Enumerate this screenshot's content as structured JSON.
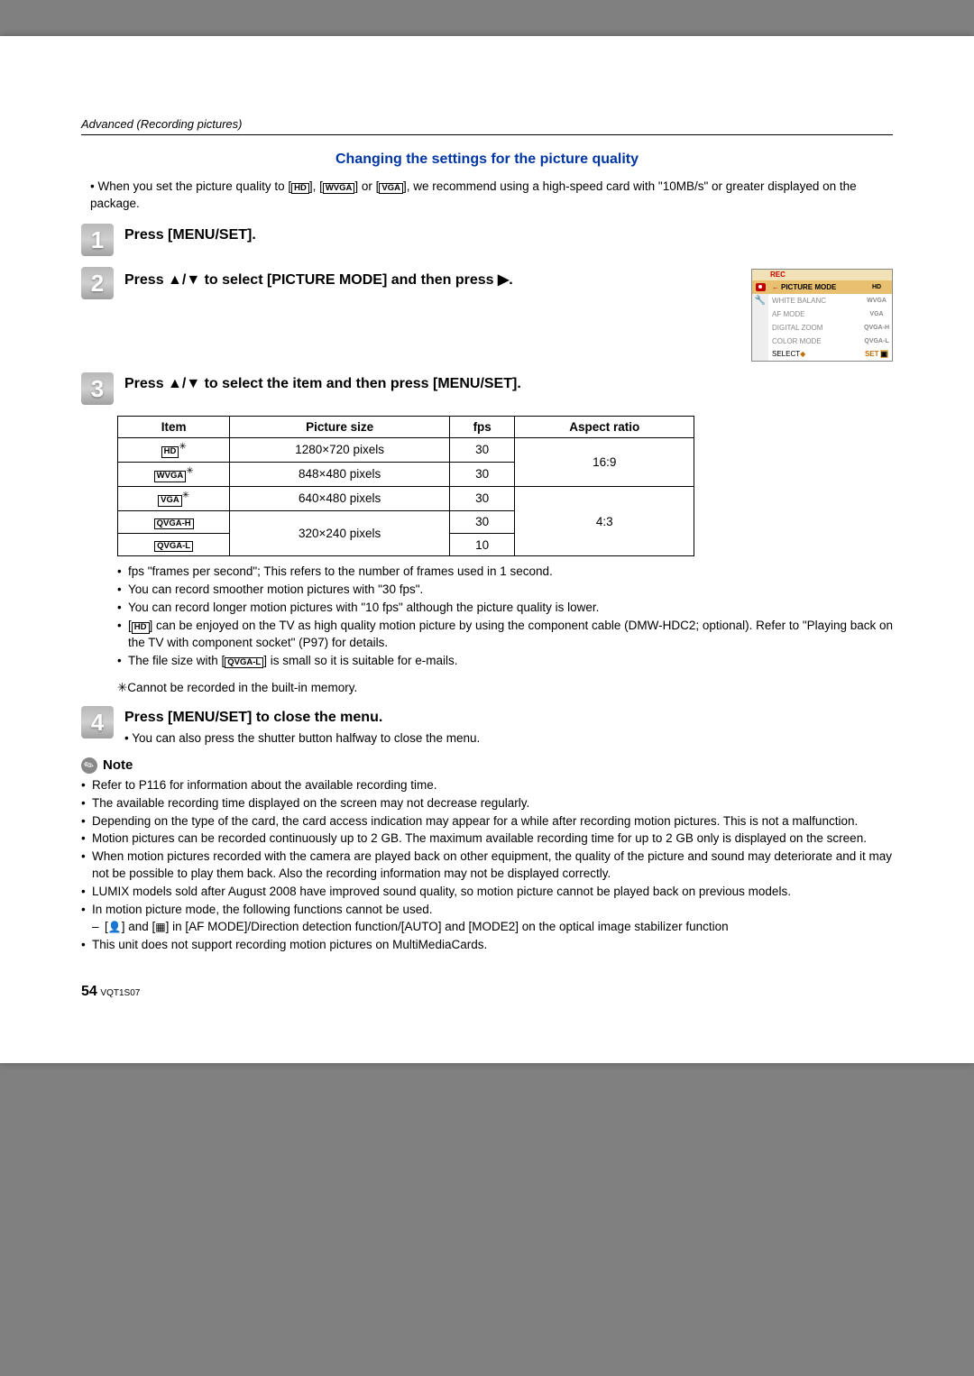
{
  "header": "Advanced (Recording pictures)",
  "section_heading": "Changing the settings for the picture quality",
  "intro": {
    "prefix": "• When you set the picture quality to [",
    "g1": "HD",
    "mid1": "], [",
    "g2": "WVGA",
    "mid2": "] or [",
    "g3": "VGA",
    "suffix": "], we recommend using a high-speed card with \"10MB/s\" or greater displayed on the package."
  },
  "steps": {
    "s1_num": "1",
    "s1_text": "Press [MENU/SET].",
    "s2_num": "2",
    "s2_text": "Press ▲/▼ to select [PICTURE MODE] and then press ▶.",
    "s3_num": "3",
    "s3_text": "Press ▲/▼ to select the item and then press [MENU/SET].",
    "s4_num": "4",
    "s4_text": "Press [MENU/SET] to close the menu.",
    "s4_sub": "• You can also press the shutter button halfway to close the menu."
  },
  "menu": {
    "title": "REC",
    "items": [
      {
        "label": "PICTURE MODE",
        "val": "HD",
        "selected": true
      },
      {
        "label": "WHITE BALANC",
        "val": "WVGA"
      },
      {
        "label": "AF MODE",
        "val": "VGA"
      },
      {
        "label": "DIGITAL ZOOM",
        "val": "QVGA-H"
      },
      {
        "label": "COLOR MODE",
        "val": "QVGA-L"
      }
    ],
    "footer_left": "SELECT",
    "footer_right": "SET"
  },
  "table": {
    "headers": [
      "Item",
      "Picture size",
      "fps",
      "Aspect ratio"
    ],
    "rows": [
      {
        "item_glyph": "HD",
        "ast": true,
        "size": "1280×720 pixels",
        "fps": "30"
      },
      {
        "item_glyph": "WVGA",
        "ast": true,
        "size": "848×480 pixels",
        "fps": "30"
      },
      {
        "item_glyph": "VGA",
        "ast": true,
        "size": "640×480 pixels",
        "fps": "30"
      },
      {
        "item_glyph": "QVGA-H",
        "ast": false,
        "size_rowspan": "320×240 pixels",
        "fps": "30"
      },
      {
        "item_glyph": "QVGA-L",
        "ast": false,
        "fps": "10"
      }
    ],
    "aspect1": "16:9",
    "aspect2": "4:3"
  },
  "table_notes": {
    "b1": "fps \"frames per second\";  This refers to the number of frames used in 1 second.",
    "b2": "You can record smoother motion pictures with \"30 fps\".",
    "b3": "You can record longer motion pictures with \"10 fps\" although the picture quality is lower.",
    "b4_pre": "[",
    "b4_g": "HD",
    "b4_post": "] can be enjoyed on the TV as high quality motion picture by using the component cable (DMW-HDC2; optional). Refer to \"Playing back on the TV with component socket\" (P97) for details.",
    "b5_pre": "The file size with [",
    "b5_g": "QVGA-L",
    "b5_post": "] is small so it is suitable for e-mails.",
    "ast_note": "✳Cannot be recorded in the built-in memory."
  },
  "note_label": "Note",
  "notes": {
    "n1": "Refer to P116 for information about the available recording time.",
    "n2": "The available recording time displayed on the screen may not decrease regularly.",
    "n3": "Depending on the type of the card, the card access indication may appear for a while after recording motion pictures. This is not a malfunction.",
    "n4": "Motion pictures can be recorded continuously up to 2 GB. The maximum available recording time for up to 2 GB only is displayed on the screen.",
    "n5": "When motion pictures recorded with the camera are played back on other equipment, the quality of the picture and sound may deteriorate and it may not be possible to play them back. Also the recording information may not be displayed correctly.",
    "n6": "LUMIX models sold after August 2008 have improved sound quality, so motion picture cannot be played back on previous models.",
    "n7": "In motion picture mode, the following functions cannot be used.",
    "n7a_pre": "[",
    "n7a_icon1": "👤",
    "n7a_mid": "] and [",
    "n7a_icon2": "▦",
    "n7a_suf": "] in [AF MODE]/Direction detection function/[AUTO] and [MODE2] on the optical image stabilizer function",
    "n8": "This unit does not support recording motion pictures on MultiMediaCards."
  },
  "footer": {
    "page": "54",
    "code": "VQT1S07"
  }
}
